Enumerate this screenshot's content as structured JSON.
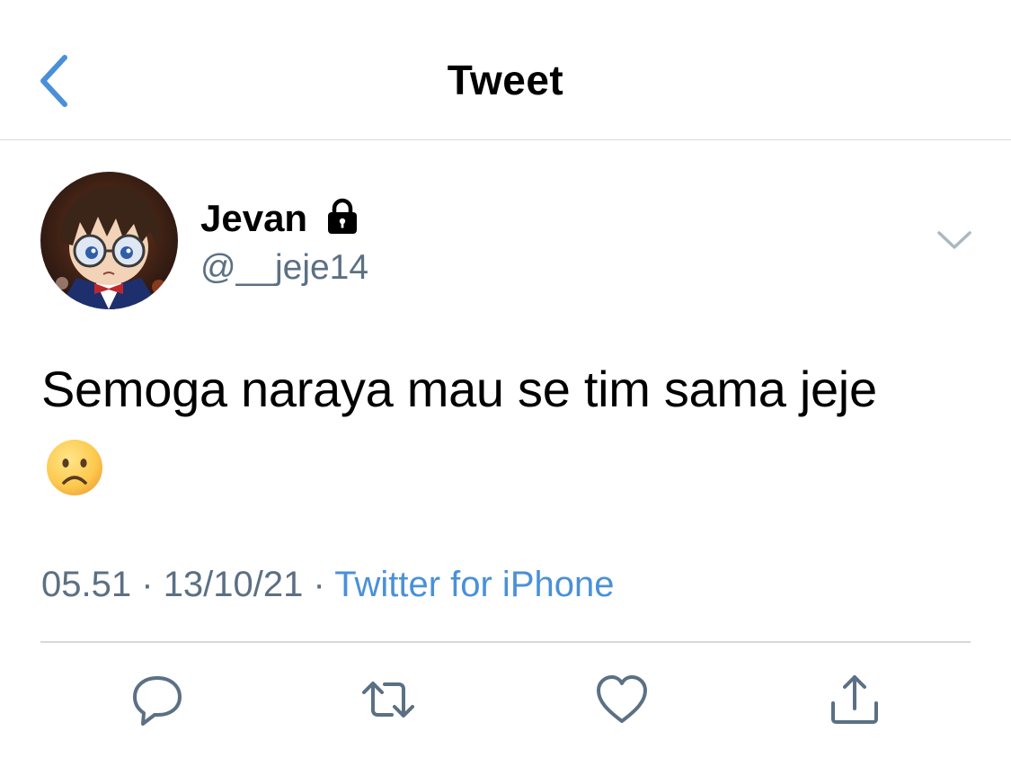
{
  "header": {
    "title": "Tweet",
    "back_icon": "chevron-left-icon"
  },
  "author": {
    "display_name": "Jevan",
    "protected_icon": "lock-icon",
    "handle": "@__jeje14"
  },
  "tweet": {
    "text": "Semoga naraya mau se tim sama jeje",
    "emoji": "frowning-face",
    "time": "05.51",
    "date": "13/10/21",
    "separator": "·",
    "source": "Twitter for iPhone"
  },
  "actions": [
    {
      "name": "reply",
      "icon": "reply-icon"
    },
    {
      "name": "retweet",
      "icon": "retweet-icon"
    },
    {
      "name": "like",
      "icon": "heart-icon"
    },
    {
      "name": "share",
      "icon": "share-icon"
    }
  ],
  "colors": {
    "accent": "#4a90d9",
    "muted": "#5b7083",
    "icon": "#5b7083",
    "divider": "#d6d9db",
    "text": "#000000"
  }
}
